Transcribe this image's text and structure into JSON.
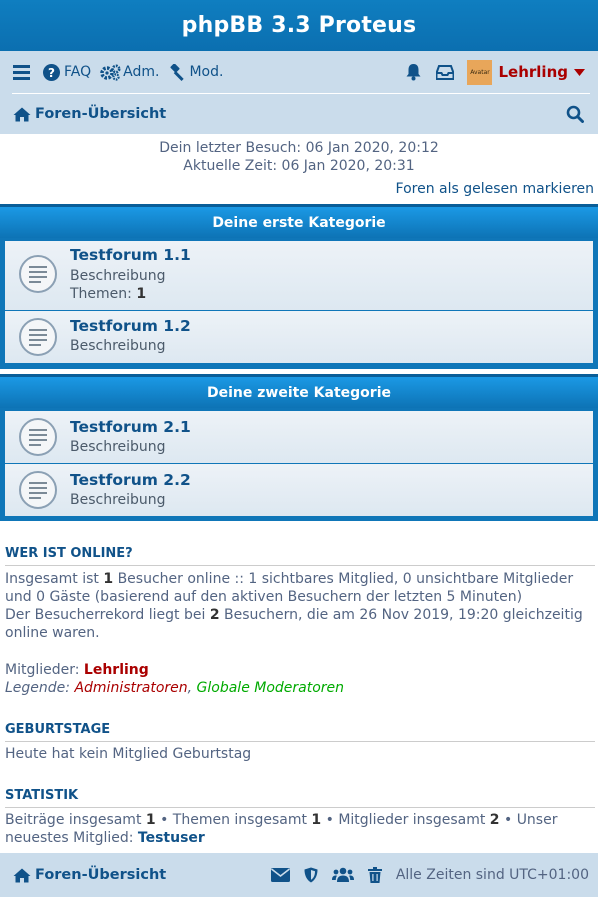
{
  "header": {
    "title": "phpBB 3.3 Proteus"
  },
  "nav": {
    "faq_label": "FAQ",
    "adm_label": "Adm.",
    "mod_label": "Mod.",
    "avatar_text": "Avatar",
    "user_name": "Lehrling",
    "breadcrumb_label": "Foren-Übersicht"
  },
  "visit": {
    "last_visit": "Dein letzter Besuch: 06 Jan 2020, 20:12",
    "current_time": "Aktuelle Zeit: 06 Jan 2020, 20:31",
    "mark_read": "Foren als gelesen markieren"
  },
  "categories": [
    {
      "title": "Deine erste Kategorie",
      "forums": [
        {
          "title": "Testforum 1.1",
          "desc": "Beschreibung",
          "topics_label": "Themen:",
          "topics_count": "1"
        },
        {
          "title": "Testforum 1.2",
          "desc": "Beschreibung"
        }
      ]
    },
    {
      "title": "Deine zweite Kategorie",
      "forums": [
        {
          "title": "Testforum 2.1",
          "desc": "Beschreibung"
        },
        {
          "title": "Testforum 2.2",
          "desc": "Beschreibung"
        }
      ]
    }
  ],
  "online": {
    "heading": "WER IST ONLINE?",
    "l1_a": "Insgesamt ist ",
    "l1_b": "1",
    "l1_c": " Besucher online :: 1 sichtbares Mitglied, 0 unsichtbare Mitglieder und 0 Gäste (basierend auf den aktiven Besuchern der letzten 5 Minuten)",
    "l2_a": "Der Besucherrekord liegt bei ",
    "l2_b": "2",
    "l2_c": " Besuchern, die am 26 Nov 2019, 19:20 gleichzeitig online waren.",
    "members_label": "Mitglieder: ",
    "members_value": "Lehrling",
    "legend_label": "Legende: ",
    "legend_admins": "Administratoren",
    "legend_sep": ", ",
    "legend_gmods": "Globale Moderatoren"
  },
  "birthdays": {
    "heading": "GEBURTSTAGE",
    "text": "Heute hat kein Mitglied Geburtstag"
  },
  "stats": {
    "heading": "STATISTIK",
    "a": "Beiträge insgesamt ",
    "a_n": "1",
    "b": " • Themen insgesamt ",
    "b_n": "1",
    "c": " • Mitglieder insgesamt ",
    "c_n": "2",
    "d": " • Unser neuestes Mitglied: ",
    "newest": "Testuser"
  },
  "footer": {
    "breadcrumb_label": "Foren-Übersicht",
    "timezone": "Alle Zeiten sind UTC+01:00"
  },
  "colors": {
    "brand_blue": "#0f7ec0",
    "nav_bg": "#cadceb",
    "link": "#105289",
    "user_red": "#aa0000",
    "gmod_green": "#00aa00"
  }
}
